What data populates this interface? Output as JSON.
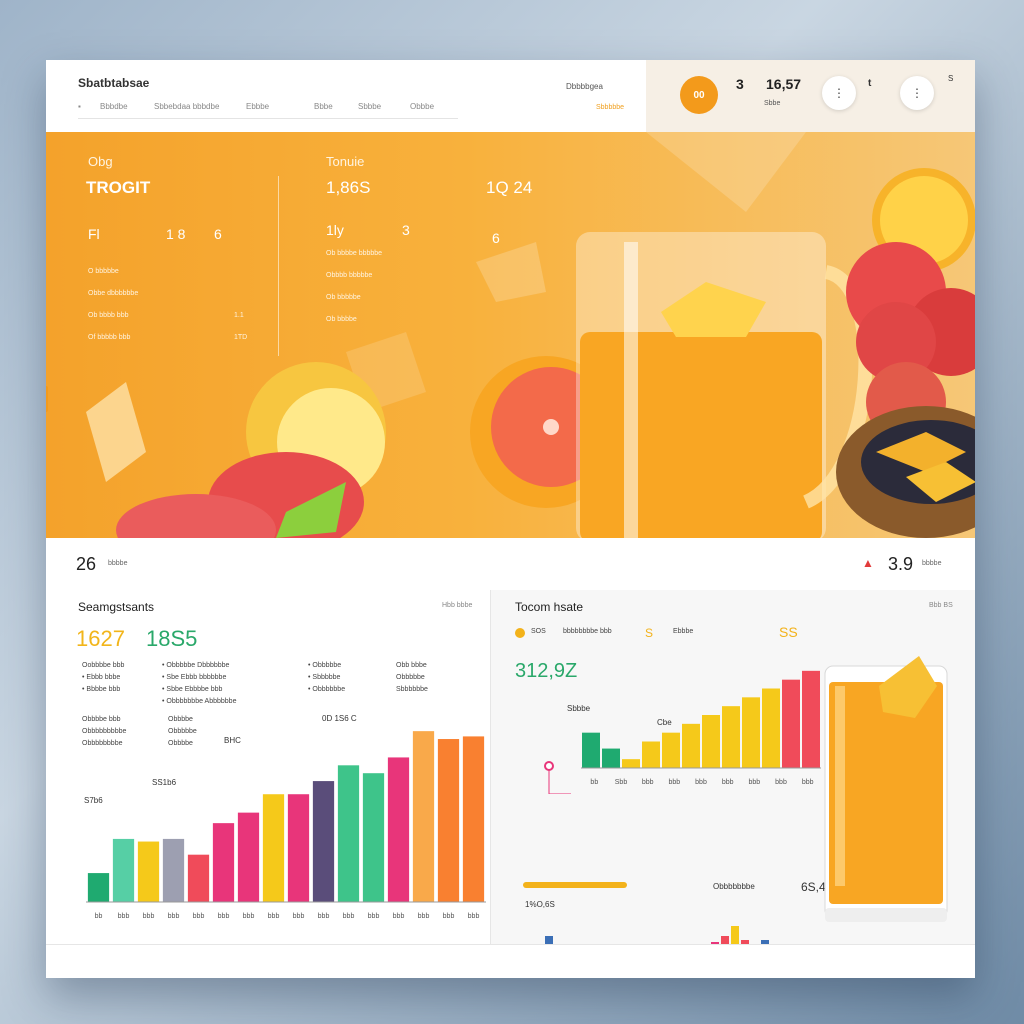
{
  "header": {
    "brand": "Sbatbtabsae",
    "nav": [
      "Bbbdbe",
      "Sbbebdaa bbbdbe",
      "Ebbbe",
      "Bbbe",
      "Sbbbe",
      "Obbbe"
    ],
    "top_link": "Dbbbbgea",
    "top_link_sub": "Sbbbbbe",
    "orange_btn": "00",
    "stat_a": "3",
    "stat_b": "16,57",
    "stat_sub": "Sbbe",
    "side_a": "t",
    "side_b": "S"
  },
  "hero": {
    "col1_label": "Obg",
    "col1_big": "TROGIT",
    "col1_rows": [
      "Fl",
      "1 8",
      "6"
    ],
    "col2_label": "Tonuie",
    "col2_big": "1,86S",
    "col2_rows": [
      "1ly",
      "3"
    ],
    "col3_big": "1Q 24",
    "col3_rows": [
      "6"
    ],
    "lines_left": [
      "O bbbbbe",
      "Obbe dbbbbbbe",
      "Ob bbbb bbb",
      "Of bbbbb bbb"
    ],
    "lines_mid": [
      "Ob bbbbe bbbbbe",
      "Obbbb bbbbbe",
      "Ob bbbbbe",
      "Ob bbbbe"
    ],
    "num_left": [
      "1.1",
      "1TD"
    ]
  },
  "strip": {
    "left_num": "26",
    "left_label": "bbbbe",
    "right_num": "3.9",
    "right_label": "bbbbe"
  },
  "left_panel": {
    "title": "Seamgstsants",
    "corner": "Hbb bbbe",
    "big_yellow": "1627",
    "big_green": "18S5",
    "lines_a": [
      "Oobbbbe bbb",
      "• Ebbb bbbe",
      "• Bbbbe bbb"
    ],
    "lines_b": [
      "• Obbbbbe Dbbbbbbe",
      "• Sbe Ebbb bbbbbbe",
      "• Sbbe Ebbbbe bbb",
      "• Obbbbbbbe Abbbbbbe"
    ],
    "lines_c": [
      "• Obbbbbe",
      "• Sbbbbbe",
      "• Obbbbbbe"
    ],
    "lines_d": [
      "Obb bbbe",
      "Obbbbbe",
      "Sbbbbbbe"
    ],
    "lines_e": [
      "Obbbbe bbb",
      "Obbbbbbbbbe",
      "Obbbbbbbbe"
    ],
    "lines_f": [
      "Obbbbe",
      "Obbbbbe",
      "Obbbbe"
    ],
    "ann_1": "0D 1S6 C",
    "ann_2": "BHC",
    "ann_3": "SS1b6",
    "ann_4": "S7b6"
  },
  "right_panel": {
    "title": "Tocom hsate",
    "corner": "Bbb BS",
    "legend_1": "SOS",
    "legend_2": "bbbbbbbbe bbb",
    "legend_3": "S",
    "legend_4": "Ebbbe",
    "legend_right": "SS",
    "green_num": "312,9Z",
    "ann_1": "Sbbbe",
    "ann_2": "Cbe",
    "mini_left_title": "1%O,6S",
    "mini_right_title": "Obbbbbbbe",
    "mini_right_num": "6S,4.3"
  },
  "chart_data": [
    {
      "type": "bar",
      "categories": [
        "bb",
        "bbb",
        "bbb",
        "bbb",
        "bbb",
        "bbb",
        "bbb",
        "bbb",
        "bbb",
        "bbb",
        "bbb",
        "bbb",
        "bbb",
        "bbb",
        "bbb",
        "bbb"
      ],
      "values": [
        22,
        48,
        46,
        48,
        36,
        60,
        68,
        82,
        82,
        92,
        104,
        98,
        110,
        130,
        124,
        126
      ],
      "colors": [
        "#1faa70",
        "#56cfa5",
        "#f5c91a",
        "#9d9fb1",
        "#f04b5a",
        "#e8357a",
        "#e8357a",
        "#f5c91a",
        "#e8357a",
        "#5a4d7a",
        "#3ec48a",
        "#3ec48a",
        "#e8357a",
        "#f9a94a",
        "#f98030",
        "#f98030"
      ],
      "ylim": [
        0,
        140
      ]
    },
    {
      "type": "bar",
      "categories": [
        "bb",
        "Sbb",
        "bbb",
        "bbb",
        "bbb",
        "bbb",
        "bbb",
        "bbb",
        "bbb"
      ],
      "values": [
        40,
        22,
        10,
        30,
        40,
        50,
        60,
        70,
        80,
        90,
        100,
        110
      ],
      "colors": [
        "#1faa70",
        "#1faa70",
        "#f5c91a",
        "#f5c91a",
        "#f5c91a",
        "#f5c91a",
        "#f5c91a",
        "#f5c91a",
        "#f5c91a",
        "#f5c91a",
        "#f04b5a",
        "#f04b5a"
      ],
      "ylim": [
        0,
        120
      ]
    }
  ]
}
